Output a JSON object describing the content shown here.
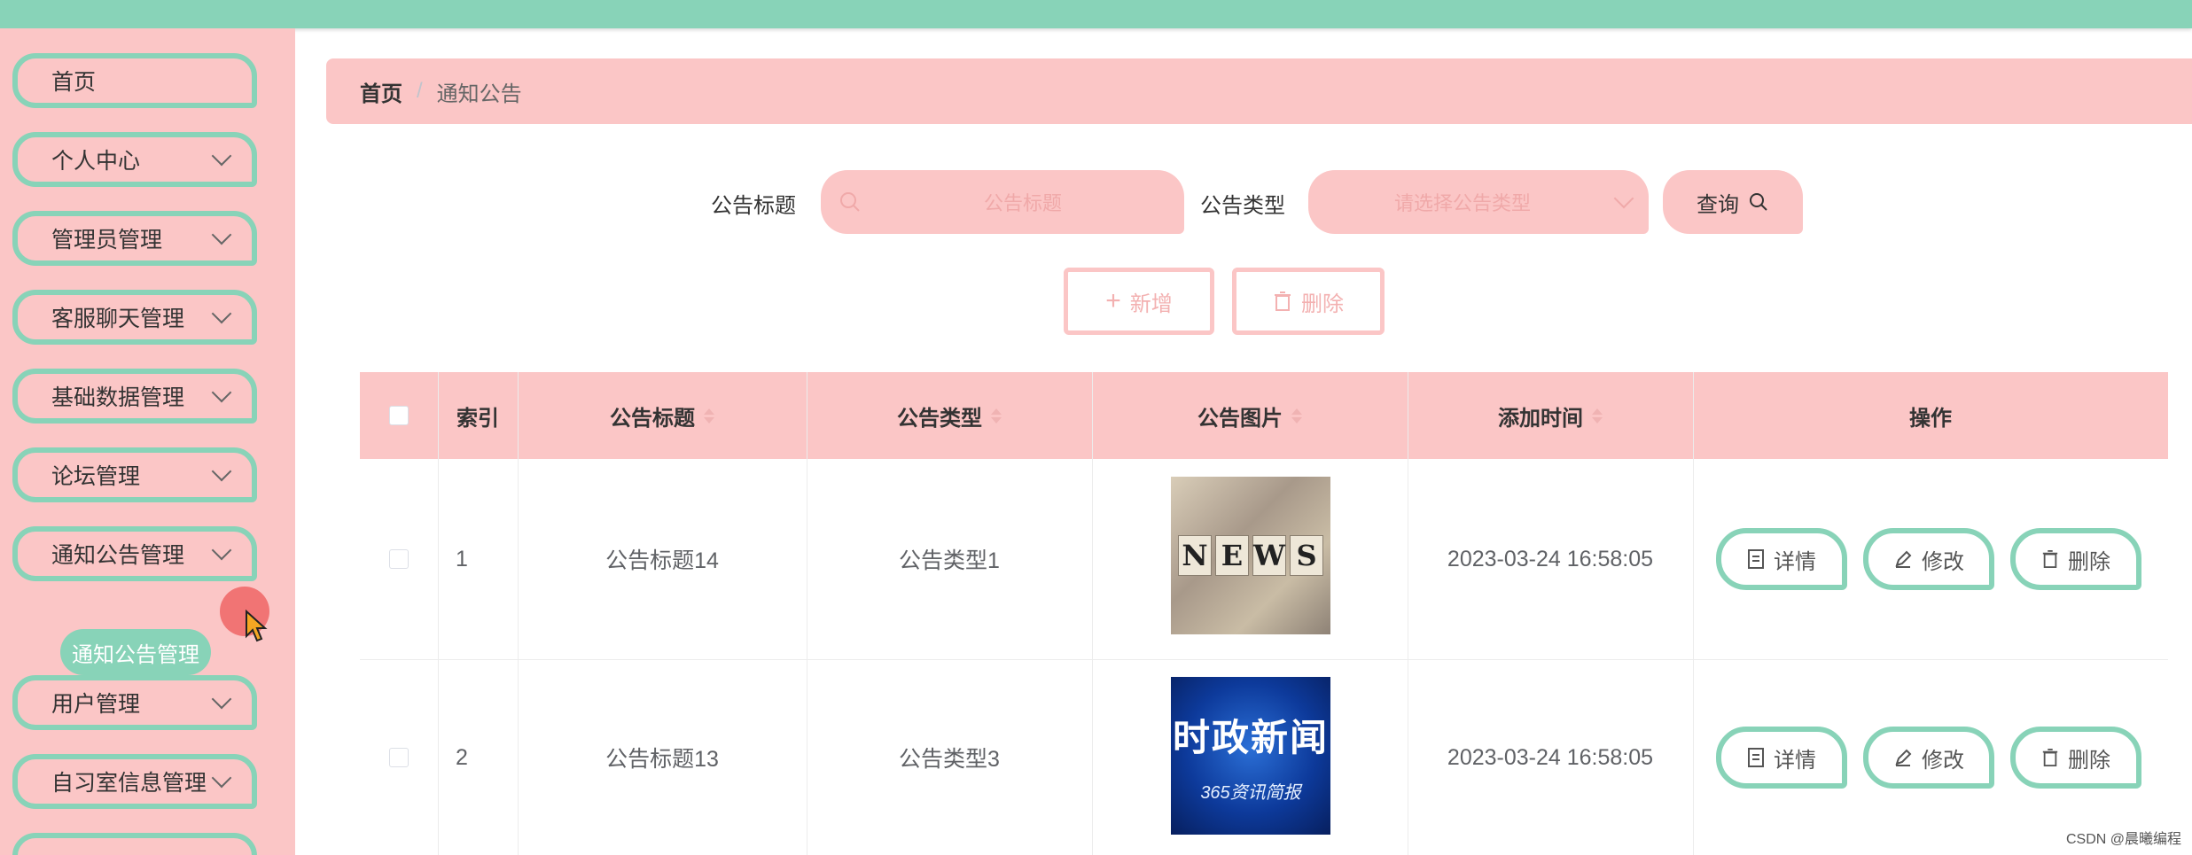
{
  "sidebar": {
    "items": [
      {
        "label": "首页",
        "has_chevron": false
      },
      {
        "label": "个人中心",
        "has_chevron": true
      },
      {
        "label": "管理员管理",
        "has_chevron": true
      },
      {
        "label": "客服聊天管理",
        "has_chevron": true
      },
      {
        "label": "基础数据管理",
        "has_chevron": true
      },
      {
        "label": "论坛管理",
        "has_chevron": true
      },
      {
        "label": "通知公告管理",
        "has_chevron": true
      },
      {
        "label": "用户管理",
        "has_chevron": true
      },
      {
        "label": "自习室信息管理",
        "has_chevron": true
      }
    ],
    "active_sub_item": "通知公告管理"
  },
  "breadcrumb": {
    "home": "首页",
    "separator": "/",
    "current": "通知公告"
  },
  "search": {
    "title_label": "公告标题",
    "title_placeholder": "公告标题",
    "type_label": "公告类型",
    "type_placeholder": "请选择公告类型",
    "query_button": "查询"
  },
  "actions": {
    "add": "新增",
    "delete": "删除"
  },
  "table": {
    "headers": {
      "index": "索引",
      "title": "公告标题",
      "type": "公告类型",
      "image": "公告图片",
      "time": "添加时间",
      "ops": "操作"
    },
    "rows": [
      {
        "index": "1",
        "title": "公告标题14",
        "type": "公告类型1",
        "image": "news-dice-image",
        "time": "2023-03-24 16:58:05"
      },
      {
        "index": "2",
        "title": "公告标题13",
        "type": "公告类型3",
        "image": "shizheng-news-image",
        "time": "2023-03-24 16:58:05"
      }
    ],
    "row_ops": {
      "detail": "详情",
      "edit": "修改",
      "delete": "删除"
    }
  },
  "images": {
    "news_letters": [
      "N",
      "E",
      "W",
      "S"
    ],
    "shizheng_title": "时政新闻",
    "shizheng_sub": "365资讯简报"
  },
  "watermark": "CSDN @晨曦编程",
  "colors": {
    "topbar": "#88d3b8",
    "sidebar": "#fbc6c6",
    "accent_green": "#88d3b8",
    "accent_pink": "#fbc6c6"
  }
}
